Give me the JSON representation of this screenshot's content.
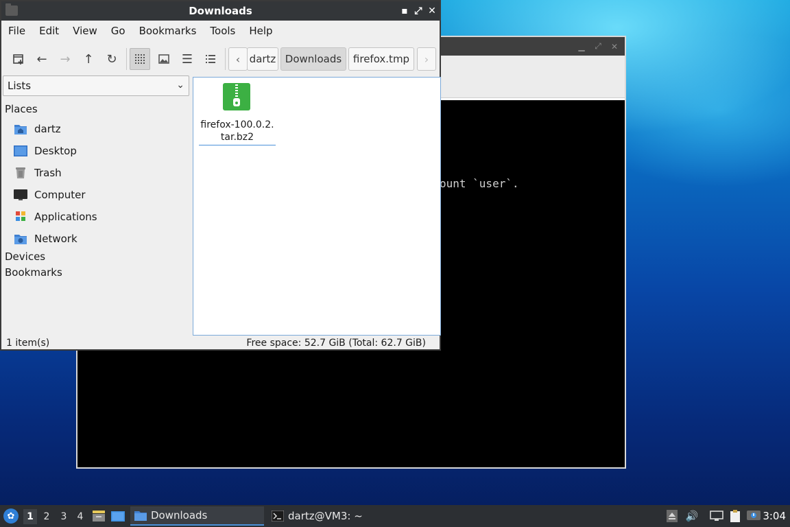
{
  "terminal": {
    "visible_text": "ount `user`.",
    "task_label": "dartz@VM3: ~"
  },
  "file_manager": {
    "title": "Downloads",
    "menu": [
      "File",
      "Edit",
      "View",
      "Go",
      "Bookmarks",
      "Tools",
      "Help"
    ],
    "breadcrumbs": [
      "dartz",
      "Downloads",
      "firefox.tmp"
    ],
    "active_breadcrumb": "Downloads",
    "sidebar": {
      "mode": "Lists",
      "places_heading": "Places",
      "places": [
        {
          "label": "dartz",
          "icon": "home-folder-icon"
        },
        {
          "label": "Desktop",
          "icon": "desktop-icon"
        },
        {
          "label": "Trash",
          "icon": "trash-icon"
        },
        {
          "label": "Computer",
          "icon": "computer-icon"
        },
        {
          "label": "Applications",
          "icon": "applications-icon"
        },
        {
          "label": "Network",
          "icon": "network-icon"
        }
      ],
      "devices_heading": "Devices",
      "bookmarks_heading": "Bookmarks"
    },
    "files": [
      {
        "name": "firefox-100.0.2.tar.bz2",
        "icon": "archive-zip-icon",
        "selected": true
      }
    ],
    "status": {
      "count": "1 item(s)",
      "free_space": "Free space: 52.7 GiB (Total: 62.7 GiB)"
    }
  },
  "taskbar": {
    "workspaces": [
      "1",
      "2",
      "3",
      "4"
    ],
    "active_workspace": "1",
    "tasks": [
      {
        "label": "Downloads",
        "icon": "folder-icon",
        "active": true
      },
      {
        "label": "dartz@VM3: ~",
        "icon": "terminal-icon",
        "active": false
      }
    ],
    "clock": "3:04"
  },
  "colors": {
    "titlebar": "#333639",
    "selection_accent": "#4a90d9",
    "archive_green": "#3cb043",
    "taskbar": "#2c2f33"
  }
}
